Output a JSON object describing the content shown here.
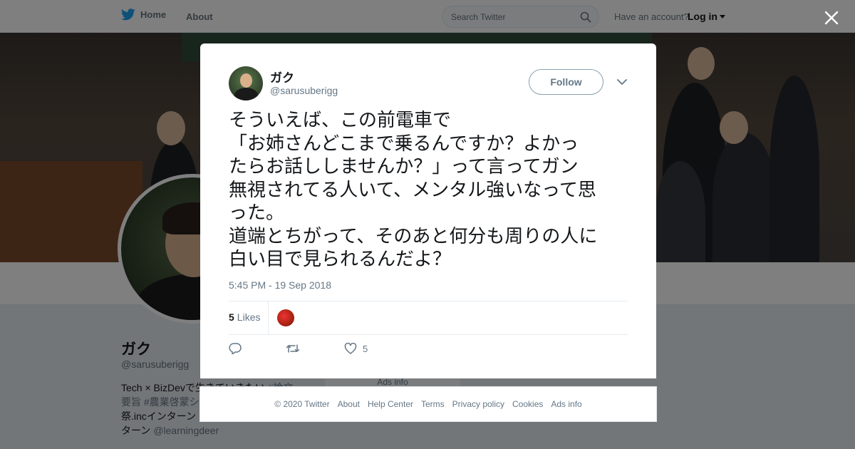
{
  "nav": {
    "home_label": "Home",
    "about_label": "About",
    "search_placeholder": "Search Twitter",
    "have_account": "Have an account?",
    "login_label": "Log in",
    "brand_color": "#1da1f2"
  },
  "profile": {
    "name": "ガク",
    "handle": "@sarusuberigg",
    "bio_line1": "Tech × BizDevで生きていきたい",
    "bio_line1_tag": "#論文",
    "bio_line2": "要旨 #農業啓蒙シ",
    "bio_line3": "祭.incインターン",
    "bio_line4": "ターン",
    "bio_mention": "@learningdeer",
    "ads_info": "Ads info"
  },
  "tweet": {
    "author_name": "ガク",
    "author_handle": "@sarusuberigg",
    "follow_label": "Follow",
    "text": "そういえば、この前電車で\n「お姉さんどこまで乗るんですか？よかっ\nたらお話ししませんか？」って言ってガン\n無視されてる人いて、メンタル強いなって思\nった。\n道端とちがって、そのあと何分も周りの人に\n白い目で見られるんだよ？",
    "timestamp": "5:45 PM - 19 Sep 2018",
    "likes_count": "5",
    "likes_label": "Likes",
    "action_like_count": "5"
  },
  "footer": {
    "links": [
      "© 2020 Twitter",
      "About",
      "Help Center",
      "Terms",
      "Privacy policy",
      "Cookies",
      "Ads info"
    ]
  }
}
